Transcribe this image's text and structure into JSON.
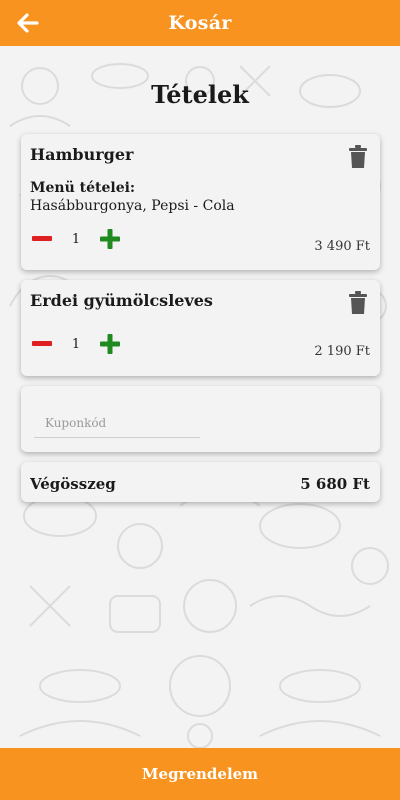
{
  "appbar": {
    "title": "Kosár",
    "back_icon": "arrow-left-icon"
  },
  "page_heading": "Tételek",
  "cart_items": [
    {
      "name": "Hamburger",
      "menu_label": "Menü tételei:",
      "menu_items": "Hasábburgonya, Pepsi - Cola",
      "quantity": "1",
      "price": "3 490 Ft"
    },
    {
      "name": "Erdei gyümölcsleves",
      "quantity": "1",
      "price": "2 190 Ft"
    }
  ],
  "coupon": {
    "placeholder": "Kuponkód",
    "value": ""
  },
  "total": {
    "label": "Végösszeg",
    "value": "5 680 Ft"
  },
  "order_button": "Megrendelem",
  "colors": {
    "accent": "#f7931e",
    "decrease": "#e02020",
    "increase": "#1f8a1f",
    "trash": "#555555"
  }
}
